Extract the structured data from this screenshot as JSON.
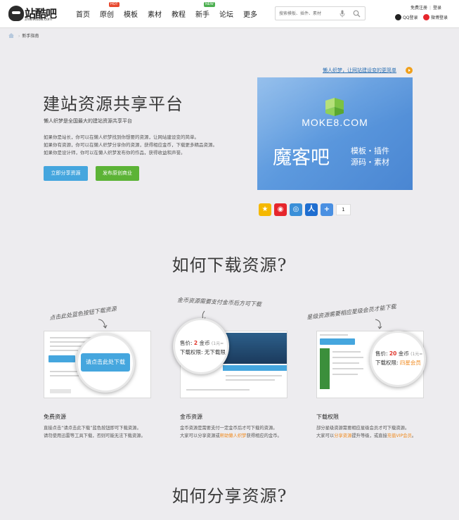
{
  "header": {
    "logo_text": "站酷吧",
    "logo_sub": "zhankuba.com",
    "nav": [
      {
        "label": "首页"
      },
      {
        "label": "原创",
        "badge": "HOT"
      },
      {
        "label": "模板"
      },
      {
        "label": "素材"
      },
      {
        "label": "教程"
      },
      {
        "label": "新手",
        "badge": "NEW"
      },
      {
        "label": "论坛"
      },
      {
        "label": "更多"
      }
    ],
    "search_placeholder": "搜索模板、插件、素材",
    "register": "免费注册",
    "login": "登录",
    "qq_login": "QQ登录",
    "weibo_login": "微博登录"
  },
  "breadcrumb": {
    "current": "新手指南"
  },
  "hero": {
    "title": "建站资源共享平台",
    "subtitle": "懒人织梦是全国最大的建站资源共享平台",
    "lines": [
      "如果你是站长，你可以在懒人织梦找到你想要的资源，让网站建设变的简单。",
      "如果你有资源，你可以在懒人织梦分享你的资源，获得相应金币，下载更多精品资源。",
      "如果你是设计师，你可以在懒人织梦发布你的作品，获得收益和声誉。"
    ],
    "share_button": "立即分享资源",
    "publish_button": "发布原创商业",
    "promo_link": "懒人织梦，让网站建设变的更简单",
    "banner_domain": "MOKE8.COM",
    "banner_cn": "魔客吧",
    "banner_tag1": "模板・插件",
    "banner_tag2": "源码・素材",
    "share_count": "1"
  },
  "download": {
    "title": "如何下载资源?",
    "notes": [
      "点击此处蓝色按钮下载资源",
      "金币资源需要支付金币后方可下载",
      "星级资源需要相应星级会员才能下载"
    ],
    "cards": [
      {
        "title": "免费资源",
        "desc1": "直接点击“请点击此下载”蓝色按钮即可下载资源。",
        "desc2": "请勿使用迅雷等工具下载，否则可能无法下载资源。",
        "magnifier_text": "请点击此处下载"
      },
      {
        "title": "金币资源",
        "desc1": "金币资源是需要支付一定金币后才可下载的资源。",
        "desc2_a": "大家可以分享资源或",
        "desc2_hl": "帮助懒人织梦",
        "desc2_b": "获得相应的金币。",
        "price_label": "售价:",
        "price_value": "2",
        "price_unit": "金币",
        "price_note": "(1元=",
        "perm_label": "下载权限:",
        "perm_value": "无下载限"
      },
      {
        "title": "下载权限",
        "desc1": "部分星级资源需要相应星级会员才可下载资源。",
        "desc2_a": "大家可以",
        "desc2_hl1": "分享资源",
        "desc2_b": "提升等级，或直接",
        "desc2_hl2": "充值VIP会员",
        "desc2_c": "。",
        "price_label": "售价:",
        "price_value": "20",
        "price_unit": "金币",
        "price_note": "(1元=",
        "perm_label": "下载权限:",
        "perm_value": "四星会员"
      }
    ]
  },
  "share": {
    "title": "如何分享资源?"
  },
  "colors": {
    "accent_blue": "#45a6de",
    "accent_green": "#5cb336",
    "link_blue": "#2a6fb3",
    "orange": "#f08a1e",
    "hot_red": "#e8492f",
    "new_green": "#4caf50"
  }
}
